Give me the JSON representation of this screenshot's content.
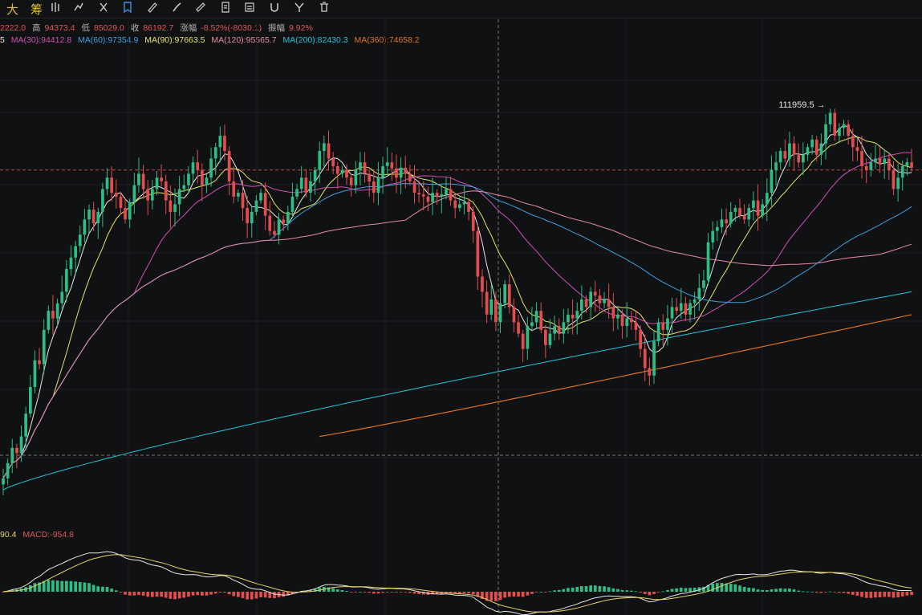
{
  "toolbar": {
    "labels": [
      "大",
      "筹"
    ],
    "icons": [
      "chart-icon",
      "ruler-icon",
      "brush-icon",
      "marker-icon",
      "note-icon",
      "pattern-icon",
      "magnet-icon",
      "fork-icon",
      "trash-icon"
    ]
  },
  "ohlc": {
    "open": "2222.0",
    "high_label": "高",
    "high": "94373.4",
    "low_label": "低",
    "low": "85029.0",
    "close_label": "收",
    "close": "86192.7",
    "change_label": "涨幅",
    "change": "-8.52%(-8030.1)",
    "amplitude_label": "振幅",
    "amplitude": "9.92%"
  },
  "ma_legend": [
    {
      "label": "5",
      "color": "#e8e8e8"
    },
    {
      "label": "MA(30):94412.8",
      "color": "#d04fb5"
    },
    {
      "label": "MA(60):97354.9",
      "color": "#3f9fe0"
    },
    {
      "label": "MA(90):97663.5",
      "color": "#e3e36b"
    },
    {
      "label": "MA(120):95565.7",
      "color": "#e88aa8"
    },
    {
      "label": "MA(200):82430.3",
      "color": "#22c5d6"
    },
    {
      "label": "MA(360):74658.2",
      "color": "#e0711f"
    }
  ],
  "peak_annotation": "111959.5",
  "macd_legend": [
    {
      "label": "90.4",
      "color": "#e8d26a"
    },
    {
      "label": "MACD:-954.8",
      "color": "#e25656"
    }
  ],
  "colors": {
    "up": "#2ebd85",
    "down": "#e24d4d",
    "background": "#101113"
  },
  "chart_data": {
    "type": "candlestick",
    "y_range": [
      62000,
      120000
    ],
    "peak": 111959.5,
    "last_price_line": 104000,
    "closes": [
      63500,
      65500,
      67500,
      66800,
      69000,
      72000,
      75500,
      79000,
      78500,
      83000,
      85500,
      84500,
      86500,
      88000,
      91000,
      92500,
      94000,
      95500,
      97500,
      98800,
      97000,
      98500,
      101500,
      103000,
      101000,
      100500,
      99000,
      97500,
      99800,
      102000,
      103500,
      101500,
      100000,
      101500,
      103000,
      102500,
      100000,
      98500,
      99500,
      101500,
      102000,
      103500,
      105000,
      104000,
      102000,
      103000,
      105500,
      107000,
      108500,
      106500,
      102500,
      100500,
      101000,
      99000,
      97000,
      98500,
      100000,
      101000,
      98000,
      96000,
      95500,
      97500,
      97000,
      98500,
      100500,
      101500,
      103000,
      101000,
      102500,
      104000,
      106500,
      107500,
      105500,
      104500,
      103500,
      104000,
      103000,
      102000,
      104000,
      105000,
      103500,
      102500,
      101000,
      103000,
      104500,
      105000,
      104200,
      103000,
      104300,
      103500,
      102500,
      101000,
      100800,
      100500,
      99800,
      101000,
      100500,
      100800,
      101500,
      100000,
      99000,
      99500,
      99800,
      98500,
      96000,
      90000,
      88000,
      85000,
      87000,
      84000,
      86500,
      89000,
      86000,
      84000,
      82500,
      80500,
      83500,
      84000,
      85500,
      83000,
      81000,
      82500,
      83500,
      82500,
      84000,
      85000,
      84500,
      85500,
      87000,
      86000,
      88000,
      87500,
      86500,
      87000,
      86000,
      84500,
      85000,
      83500,
      84500,
      84000,
      83000,
      80500,
      78000,
      77000,
      81500,
      84000,
      83000,
      84500,
      86000,
      85500,
      86500,
      85000,
      86500,
      87000,
      88500,
      89500,
      94500,
      96000,
      96500,
      97500,
      97000,
      98500,
      99000,
      98000,
      97500,
      99000,
      100000,
      98000,
      99500,
      101000,
      104000,
      105000,
      106500,
      105500,
      107500,
      106000,
      105000,
      106000,
      107000,
      108000,
      106000,
      107500,
      110000,
      111500,
      108500,
      109500,
      110000,
      108500,
      107000,
      106500,
      104500,
      104000,
      105000,
      105500,
      104800,
      105500,
      104000,
      101500,
      103000,
      104500,
      105000,
      104300
    ]
  }
}
